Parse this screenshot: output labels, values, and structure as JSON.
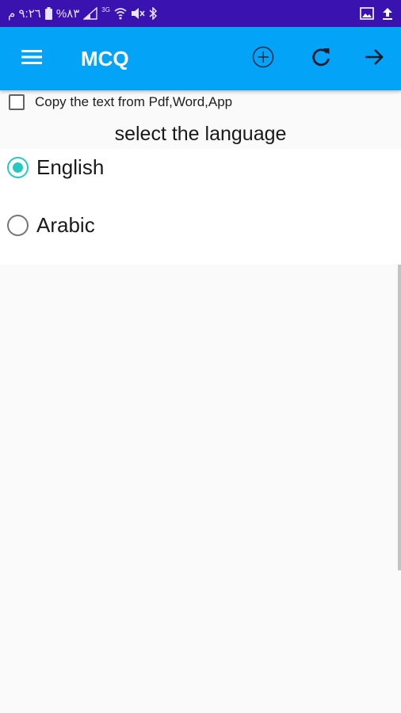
{
  "status_bar": {
    "time": "٩:٢٦ م",
    "battery": "%٨٣",
    "network_label": "3G",
    "icons": [
      "signal-icon",
      "wifi-icon",
      "mute-icon",
      "bluetooth-icon",
      "image-icon",
      "upload-icon"
    ],
    "background": "#3a12b0"
  },
  "app_bar": {
    "title": "MCQ",
    "background": "#03a4f8",
    "icons": [
      "menu-icon",
      "add-circle-icon",
      "refresh-icon",
      "arrow-forward-icon"
    ]
  },
  "content": {
    "copy_checkbox": {
      "label": "Copy the text from Pdf,Word,App",
      "checked": false
    },
    "language_heading": "select the language",
    "languages": [
      {
        "label": "English",
        "selected": true
      },
      {
        "label": "Arabic",
        "selected": false
      }
    ],
    "accent_color": "#27c8c0"
  }
}
